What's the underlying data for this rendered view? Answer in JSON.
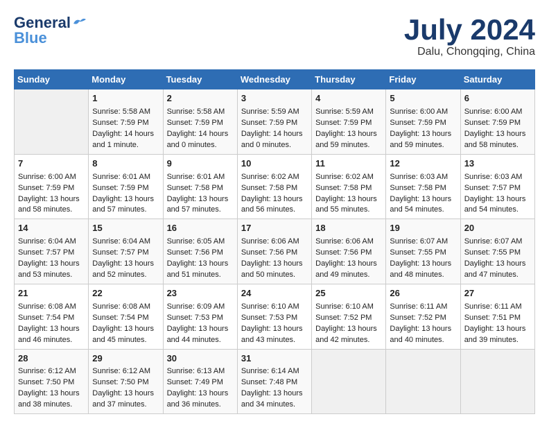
{
  "header": {
    "logo_line1": "General",
    "logo_line2": "Blue",
    "month_title": "July 2024",
    "location": "Dalu, Chongqing, China"
  },
  "weekdays": [
    "Sunday",
    "Monday",
    "Tuesday",
    "Wednesday",
    "Thursday",
    "Friday",
    "Saturday"
  ],
  "weeks": [
    [
      {
        "day": "",
        "empty": true
      },
      {
        "day": "1",
        "sunrise": "5:58 AM",
        "sunset": "7:59 PM",
        "daylight": "14 hours and 1 minute."
      },
      {
        "day": "2",
        "sunrise": "5:58 AM",
        "sunset": "7:59 PM",
        "daylight": "14 hours and 0 minutes."
      },
      {
        "day": "3",
        "sunrise": "5:59 AM",
        "sunset": "7:59 PM",
        "daylight": "14 hours and 0 minutes."
      },
      {
        "day": "4",
        "sunrise": "5:59 AM",
        "sunset": "7:59 PM",
        "daylight": "13 hours and 59 minutes."
      },
      {
        "day": "5",
        "sunrise": "6:00 AM",
        "sunset": "7:59 PM",
        "daylight": "13 hours and 59 minutes."
      },
      {
        "day": "6",
        "sunrise": "6:00 AM",
        "sunset": "7:59 PM",
        "daylight": "13 hours and 58 minutes."
      }
    ],
    [
      {
        "day": "7",
        "sunrise": "6:00 AM",
        "sunset": "7:59 PM",
        "daylight": "13 hours and 58 minutes."
      },
      {
        "day": "8",
        "sunrise": "6:01 AM",
        "sunset": "7:59 PM",
        "daylight": "13 hours and 57 minutes."
      },
      {
        "day": "9",
        "sunrise": "6:01 AM",
        "sunset": "7:58 PM",
        "daylight": "13 hours and 57 minutes."
      },
      {
        "day": "10",
        "sunrise": "6:02 AM",
        "sunset": "7:58 PM",
        "daylight": "13 hours and 56 minutes."
      },
      {
        "day": "11",
        "sunrise": "6:02 AM",
        "sunset": "7:58 PM",
        "daylight": "13 hours and 55 minutes."
      },
      {
        "day": "12",
        "sunrise": "6:03 AM",
        "sunset": "7:58 PM",
        "daylight": "13 hours and 54 minutes."
      },
      {
        "day": "13",
        "sunrise": "6:03 AM",
        "sunset": "7:57 PM",
        "daylight": "13 hours and 54 minutes."
      }
    ],
    [
      {
        "day": "14",
        "sunrise": "6:04 AM",
        "sunset": "7:57 PM",
        "daylight": "13 hours and 53 minutes."
      },
      {
        "day": "15",
        "sunrise": "6:04 AM",
        "sunset": "7:57 PM",
        "daylight": "13 hours and 52 minutes."
      },
      {
        "day": "16",
        "sunrise": "6:05 AM",
        "sunset": "7:56 PM",
        "daylight": "13 hours and 51 minutes."
      },
      {
        "day": "17",
        "sunrise": "6:06 AM",
        "sunset": "7:56 PM",
        "daylight": "13 hours and 50 minutes."
      },
      {
        "day": "18",
        "sunrise": "6:06 AM",
        "sunset": "7:56 PM",
        "daylight": "13 hours and 49 minutes."
      },
      {
        "day": "19",
        "sunrise": "6:07 AM",
        "sunset": "7:55 PM",
        "daylight": "13 hours and 48 minutes."
      },
      {
        "day": "20",
        "sunrise": "6:07 AM",
        "sunset": "7:55 PM",
        "daylight": "13 hours and 47 minutes."
      }
    ],
    [
      {
        "day": "21",
        "sunrise": "6:08 AM",
        "sunset": "7:54 PM",
        "daylight": "13 hours and 46 minutes."
      },
      {
        "day": "22",
        "sunrise": "6:08 AM",
        "sunset": "7:54 PM",
        "daylight": "13 hours and 45 minutes."
      },
      {
        "day": "23",
        "sunrise": "6:09 AM",
        "sunset": "7:53 PM",
        "daylight": "13 hours and 44 minutes."
      },
      {
        "day": "24",
        "sunrise": "6:10 AM",
        "sunset": "7:53 PM",
        "daylight": "13 hours and 43 minutes."
      },
      {
        "day": "25",
        "sunrise": "6:10 AM",
        "sunset": "7:52 PM",
        "daylight": "13 hours and 42 minutes."
      },
      {
        "day": "26",
        "sunrise": "6:11 AM",
        "sunset": "7:52 PM",
        "daylight": "13 hours and 40 minutes."
      },
      {
        "day": "27",
        "sunrise": "6:11 AM",
        "sunset": "7:51 PM",
        "daylight": "13 hours and 39 minutes."
      }
    ],
    [
      {
        "day": "28",
        "sunrise": "6:12 AM",
        "sunset": "7:50 PM",
        "daylight": "13 hours and 38 minutes."
      },
      {
        "day": "29",
        "sunrise": "6:12 AM",
        "sunset": "7:50 PM",
        "daylight": "13 hours and 37 minutes."
      },
      {
        "day": "30",
        "sunrise": "6:13 AM",
        "sunset": "7:49 PM",
        "daylight": "13 hours and 36 minutes."
      },
      {
        "day": "31",
        "sunrise": "6:14 AM",
        "sunset": "7:48 PM",
        "daylight": "13 hours and 34 minutes."
      },
      {
        "day": "",
        "empty": true
      },
      {
        "day": "",
        "empty": true
      },
      {
        "day": "",
        "empty": true
      }
    ]
  ]
}
